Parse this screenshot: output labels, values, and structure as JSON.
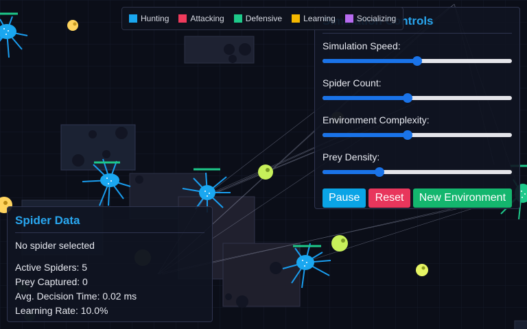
{
  "colors": {
    "background": "#0b0e18",
    "accent": "#29a7f0",
    "hunting": "#1aa7f0",
    "attacking": "#ef3b5c",
    "defensive": "#1ec98a",
    "learning": "#f5b800",
    "socializing": "#b86bf0"
  },
  "legend": [
    {
      "label": "Hunting",
      "color": "#1aa7f0"
    },
    {
      "label": "Attacking",
      "color": "#ef3b5c"
    },
    {
      "label": "Defensive",
      "color": "#1ec98a"
    },
    {
      "label": "Learning",
      "color": "#f5b800"
    },
    {
      "label": "Socializing",
      "color": "#b86bf0"
    }
  ],
  "controls": {
    "title": "Simulation Controls",
    "sliders": [
      {
        "label": "Simulation Speed:",
        "value": 0.5
      },
      {
        "label": "Spider Count:",
        "value": 0.45
      },
      {
        "label": "Environment Complexity:",
        "value": 0.45
      },
      {
        "label": "Prey Density:",
        "value": 0.3
      }
    ],
    "pause_label": "Pause",
    "reset_label": "Reset",
    "new_env_label": "New Environment"
  },
  "info": {
    "title": "Spider Data",
    "selected": "No spider selected",
    "active_spiders": "Active Spiders: 5",
    "prey_captured": "Prey Captured: 0",
    "decision_time": "Avg. Decision Time: 0.02 ms",
    "learning_rate": "Learning Rate: 10.0%"
  }
}
